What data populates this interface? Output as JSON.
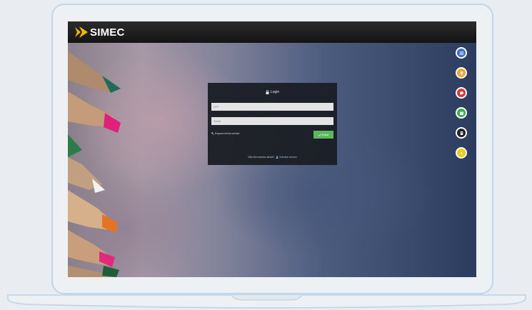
{
  "app": {
    "brand": "SIMEC"
  },
  "login": {
    "title": "Login",
    "cpf_placeholder": "CPF",
    "password_placeholder": "Senha",
    "forgot_label": "Esqueci minha senha!",
    "enter_label": "Entrar",
    "no_access_text": "Não tem acesso ainda?",
    "request_label": "Solicitar acesso"
  },
  "side_buttons": [
    {
      "name": "menu-icon",
      "color": "#3a6fc4"
    },
    {
      "name": "lightbulb-icon",
      "color": "#f0a030"
    },
    {
      "name": "chat-icon",
      "color": "#d9383a"
    },
    {
      "name": "calendar-icon",
      "color": "#3caa4b"
    },
    {
      "name": "document-icon",
      "color": "#222222"
    },
    {
      "name": "bolt-icon",
      "color": "#e8cc16"
    }
  ],
  "colors": {
    "accent_green": "#5cb85c",
    "topbar": "#1a1a1a"
  }
}
